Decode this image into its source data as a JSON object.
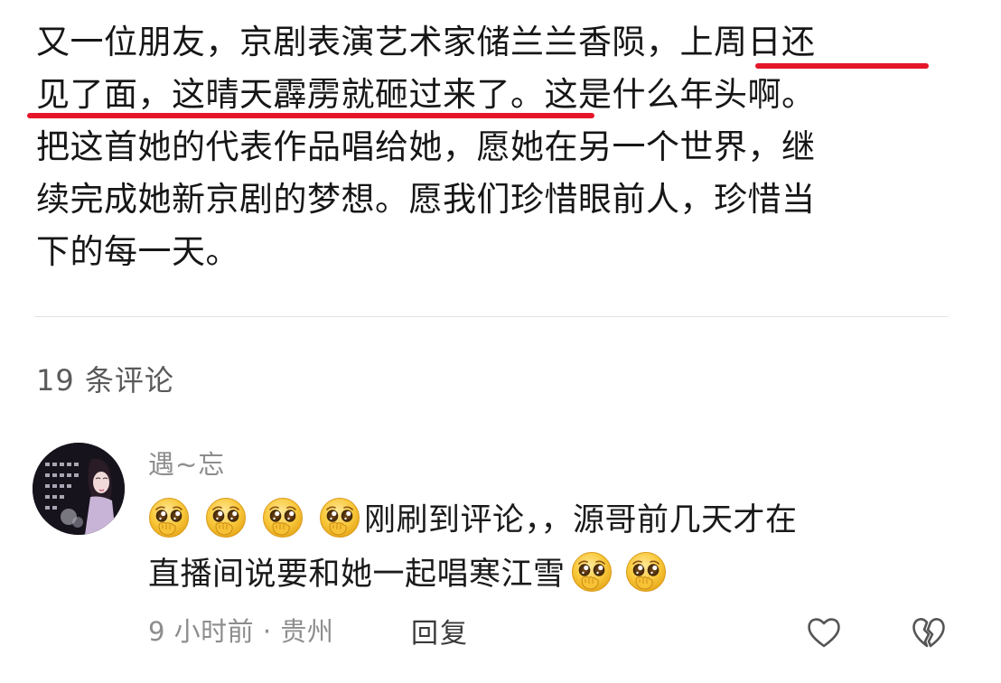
{
  "post": {
    "lines": [
      "又一位朋友，京剧表演艺术家储兰兰香陨，上周日还",
      "见了面，这晴天霹雳就砸过来了。这是什么年头啊。",
      "把这首她的代表作品唱给她，愿她在另一个世界，继",
      "续完成她新京剧的梦想。愿我们珍惜眼前人，珍惜当",
      "下的每一天。"
    ],
    "highlight_color": "#e5162a"
  },
  "comments_header": "19 条评论",
  "comment": {
    "avatar_icon": "avatar-portrait-icon",
    "username": "遇~忘",
    "emoji_icon": "pleading-face-emoji-icon",
    "text_line1": "刚刷到评论，，源哥前几天才在",
    "text_line2": "直播间说要和她一起唱寒江雪",
    "time_location": "9 小时前 · 贵州",
    "reply_label": "回复",
    "like_icon": "heart-outline-icon",
    "dislike_icon": "broken-heart-icon"
  }
}
